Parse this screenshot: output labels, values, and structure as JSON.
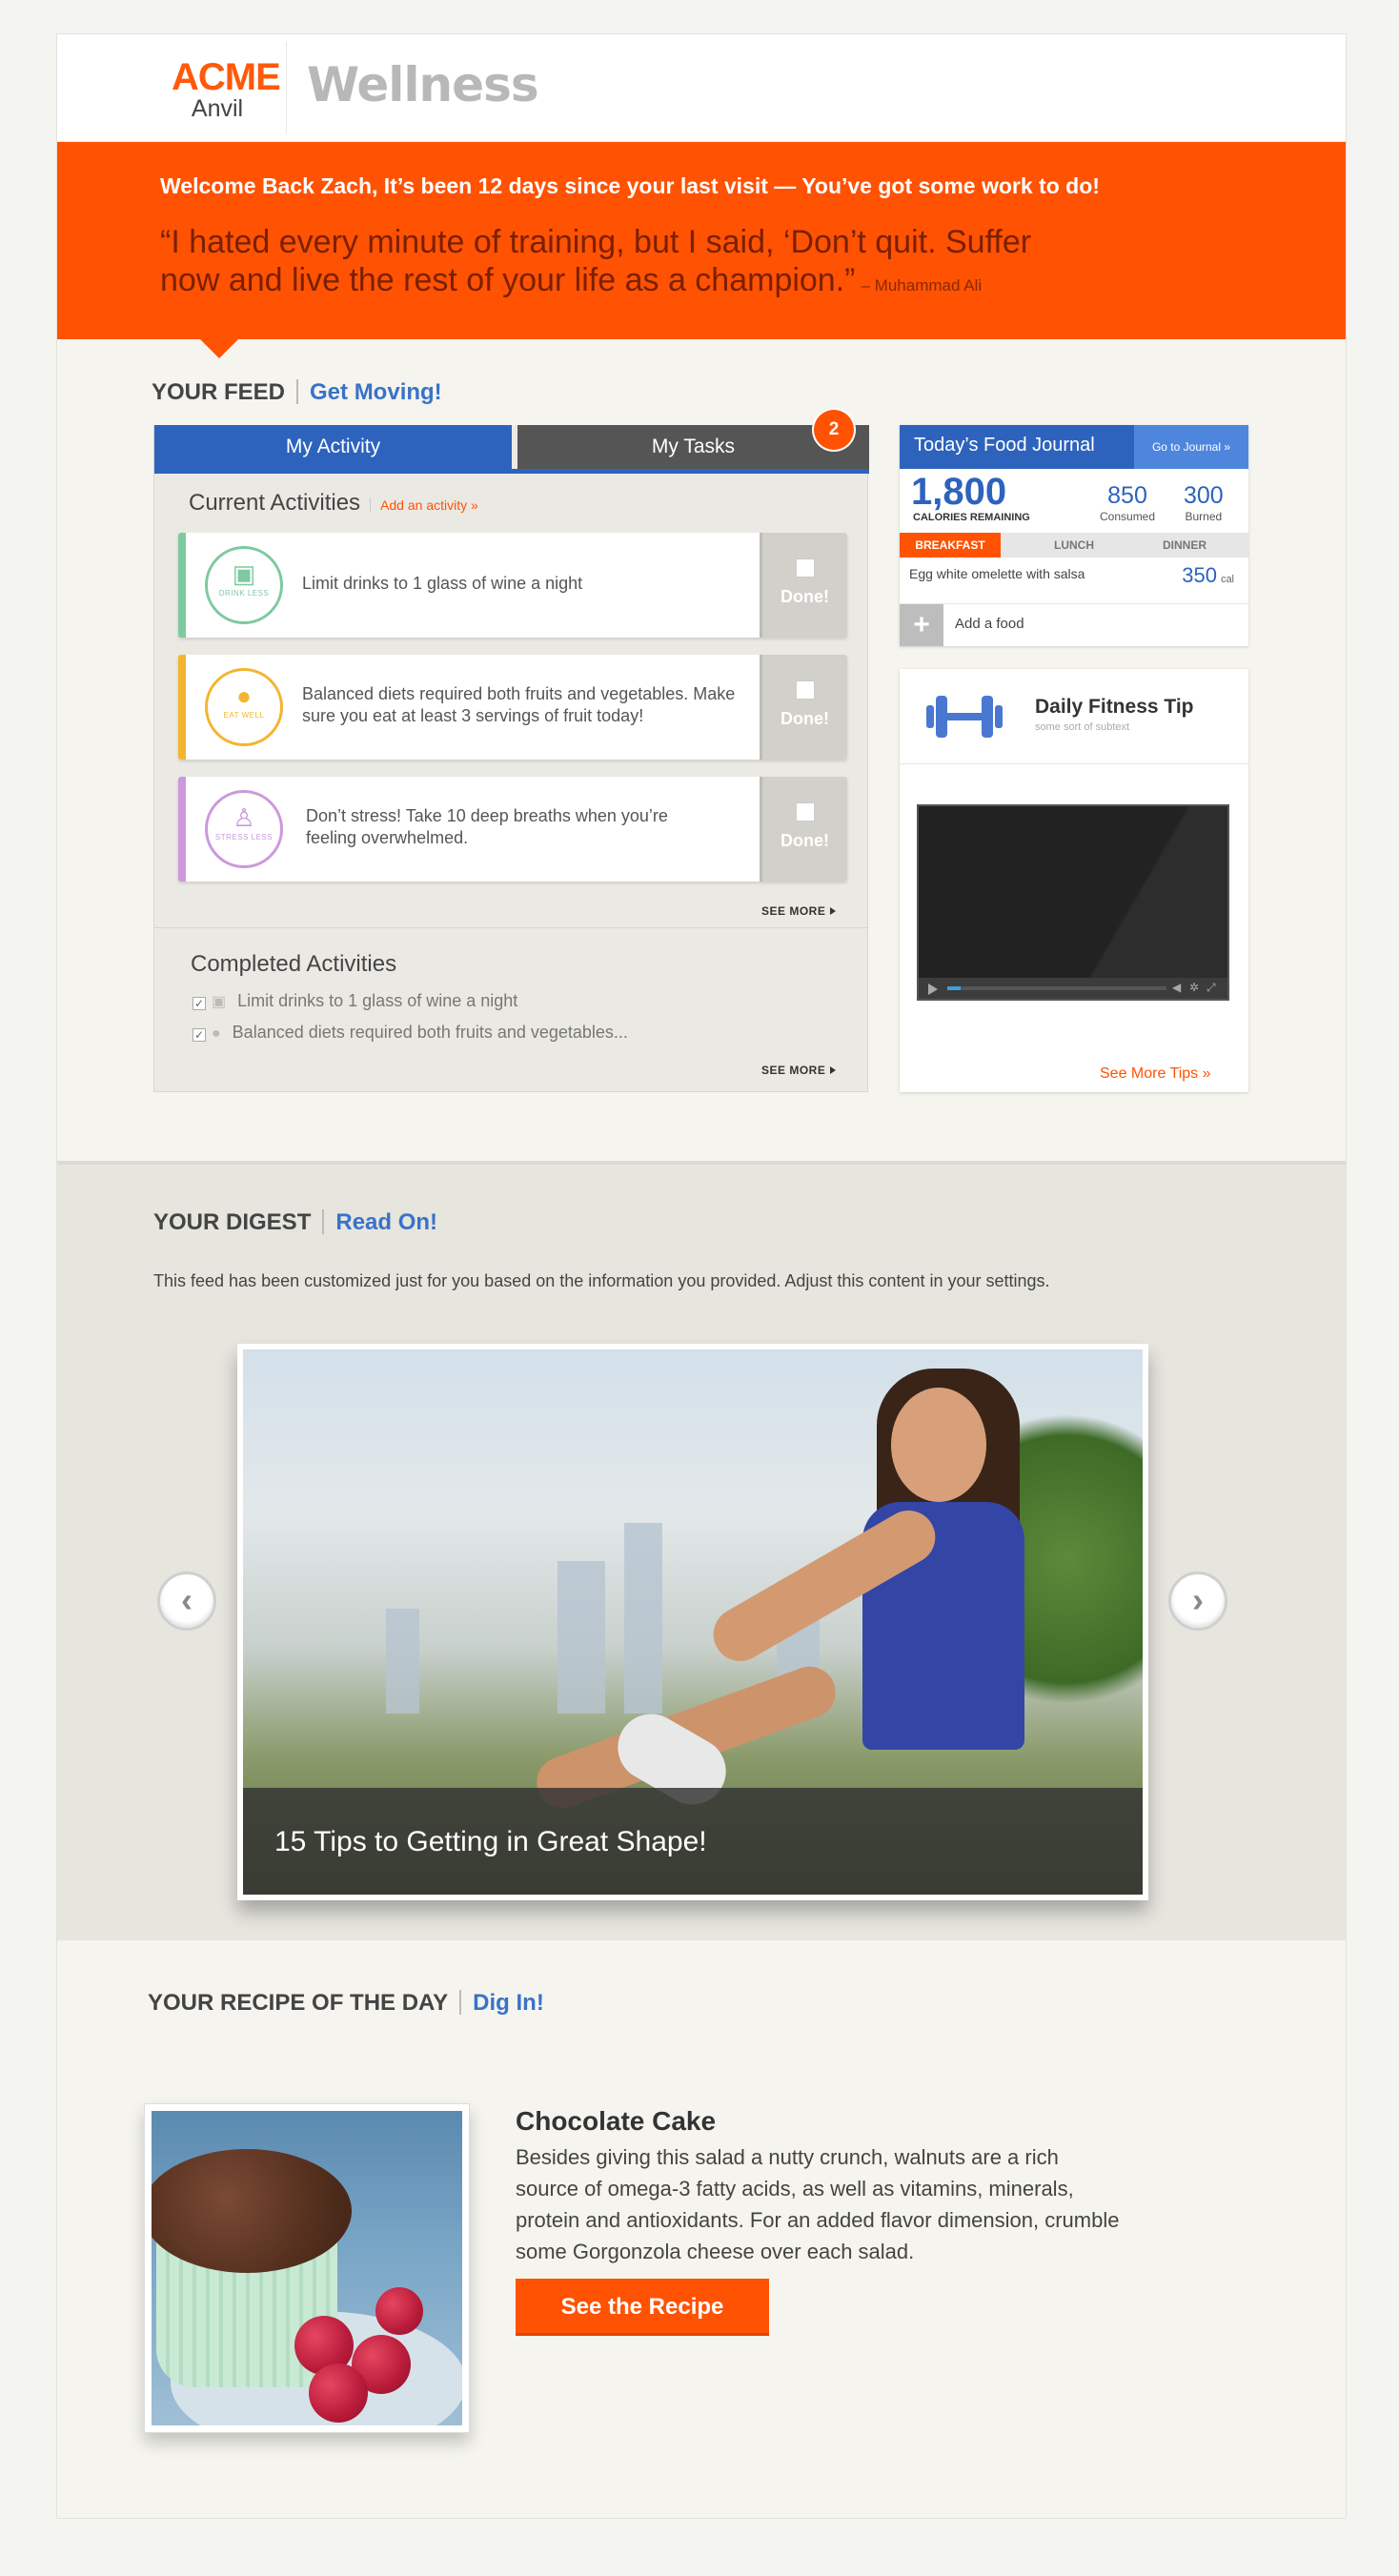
{
  "brand": {
    "logo_top": "ACME",
    "logo_bottom": "Anvil",
    "product": "Wellness",
    "accent": "#ff5203",
    "blue": "#2d63bd"
  },
  "hero": {
    "welcome": "Welcome Back Zach, It’s been 12 days since your last visit — You’ve got some work to do!",
    "quote": "“I hated every minute of training, but I said, ‘Don’t quit. Suffer now and live the rest of your life as a champion.”",
    "author": "– Muhammad Ali"
  },
  "feed": {
    "title": "YOUR FEED",
    "accent": "Get Moving!",
    "tabs": [
      {
        "label": "My Activity",
        "active": true
      },
      {
        "label": "My Tasks",
        "active": false
      }
    ],
    "tasks_badge": "2",
    "current_title": "Current Activities",
    "add_activity": "Add an activity »",
    "activities": [
      {
        "icon": "drink-cup-icon",
        "icon_caption": "DRINK LESS",
        "text": "Limit drinks to 1 glass of wine a night",
        "done_label": "Done!",
        "color": "#7ec9a0"
      },
      {
        "icon": "apple-icon",
        "icon_caption": "EAT WELL",
        "text": "Balanced diets required both fruits and vegetables. Make sure you eat at least 3 servings of fruit today!",
        "done_label": "Done!",
        "color": "#f3b530"
      },
      {
        "icon": "meditation-icon",
        "icon_caption": "STRESS LESS",
        "text": "Don’t stress! Take 10 deep breaths when you’re feeling overwhelmed.",
        "done_label": "Done!",
        "color": "#cc99dd"
      }
    ],
    "see_more": "SEE MORE",
    "completed_title": "Completed Activities",
    "completed": [
      {
        "icon": "drink-cup-icon",
        "text": "Limit drinks to 1 glass of wine a night"
      },
      {
        "icon": "apple-icon",
        "text": "Balanced diets required both fruits and vegetables..."
      }
    ],
    "see_more_2": "SEE MORE"
  },
  "food_journal": {
    "title": "Today’s Food Journal",
    "go_link": "Go to Journal »",
    "calories_remaining": "1,800",
    "calories_caption": "CALORIES REMAINING",
    "consumed_value": "850",
    "consumed_label": "Consumed",
    "burned_value": "300",
    "burned_label": "Burned",
    "meals": [
      "BREAKFAST",
      "LUNCH",
      "DINNER"
    ],
    "active_meal": "BREAKFAST",
    "item": "Egg white omelette with salsa",
    "item_cal": "350",
    "cal_unit": "cal",
    "add_food": "Add a food"
  },
  "fitness_tip": {
    "title": "Daily Fitness Tip",
    "subtitle": "some sort of subtext",
    "icon": "dumbbell-icon",
    "video_progress": 0.06,
    "see_more": "See More Tips »"
  },
  "digest": {
    "title": "YOUR DIGEST",
    "accent": "Read On!",
    "note": "This feed has been customized just for you based on the information you provided. Adjust this content in your settings.",
    "slide_caption": "15 Tips to Getting in Great Shape!",
    "prev_icon": "chevron-left-icon",
    "next_icon": "chevron-right-icon"
  },
  "recipe": {
    "title": "YOUR RECIPE OF THE DAY",
    "accent": "Dig In!",
    "name": "Chocolate Cake",
    "description": "Besides giving this salad a nutty crunch, walnuts are a rich source of omega-3 fatty acids, as well as vitamins, minerals, protein and antioxidants. For an added flavor dimension, crumble some Gorgonzola cheese over each salad.",
    "button": "See the Recipe"
  }
}
